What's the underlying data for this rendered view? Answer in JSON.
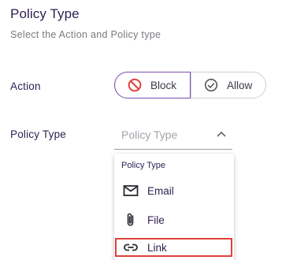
{
  "header": {
    "title": "Policy Type",
    "subtitle": "Select the Action and Policy type"
  },
  "action": {
    "label": "Action",
    "options": [
      {
        "label": "Block",
        "icon": "block-icon",
        "selected": true
      },
      {
        "label": "Allow",
        "icon": "check-circle-icon",
        "selected": false
      }
    ]
  },
  "policy_type": {
    "label": "Policy Type",
    "placeholder": "Policy Type",
    "expanded": true,
    "menu": {
      "header": "Policy Type",
      "items": [
        {
          "label": "Email",
          "icon": "mail-icon"
        },
        {
          "label": "File",
          "icon": "paperclip-icon"
        },
        {
          "label": "Link",
          "icon": "link-icon",
          "highlighted": true
        }
      ]
    }
  },
  "colors": {
    "accent": "#7b4fb0",
    "text_primary": "#2f2153",
    "block_icon": "#e0413d",
    "highlight_border": "#e0413d"
  }
}
